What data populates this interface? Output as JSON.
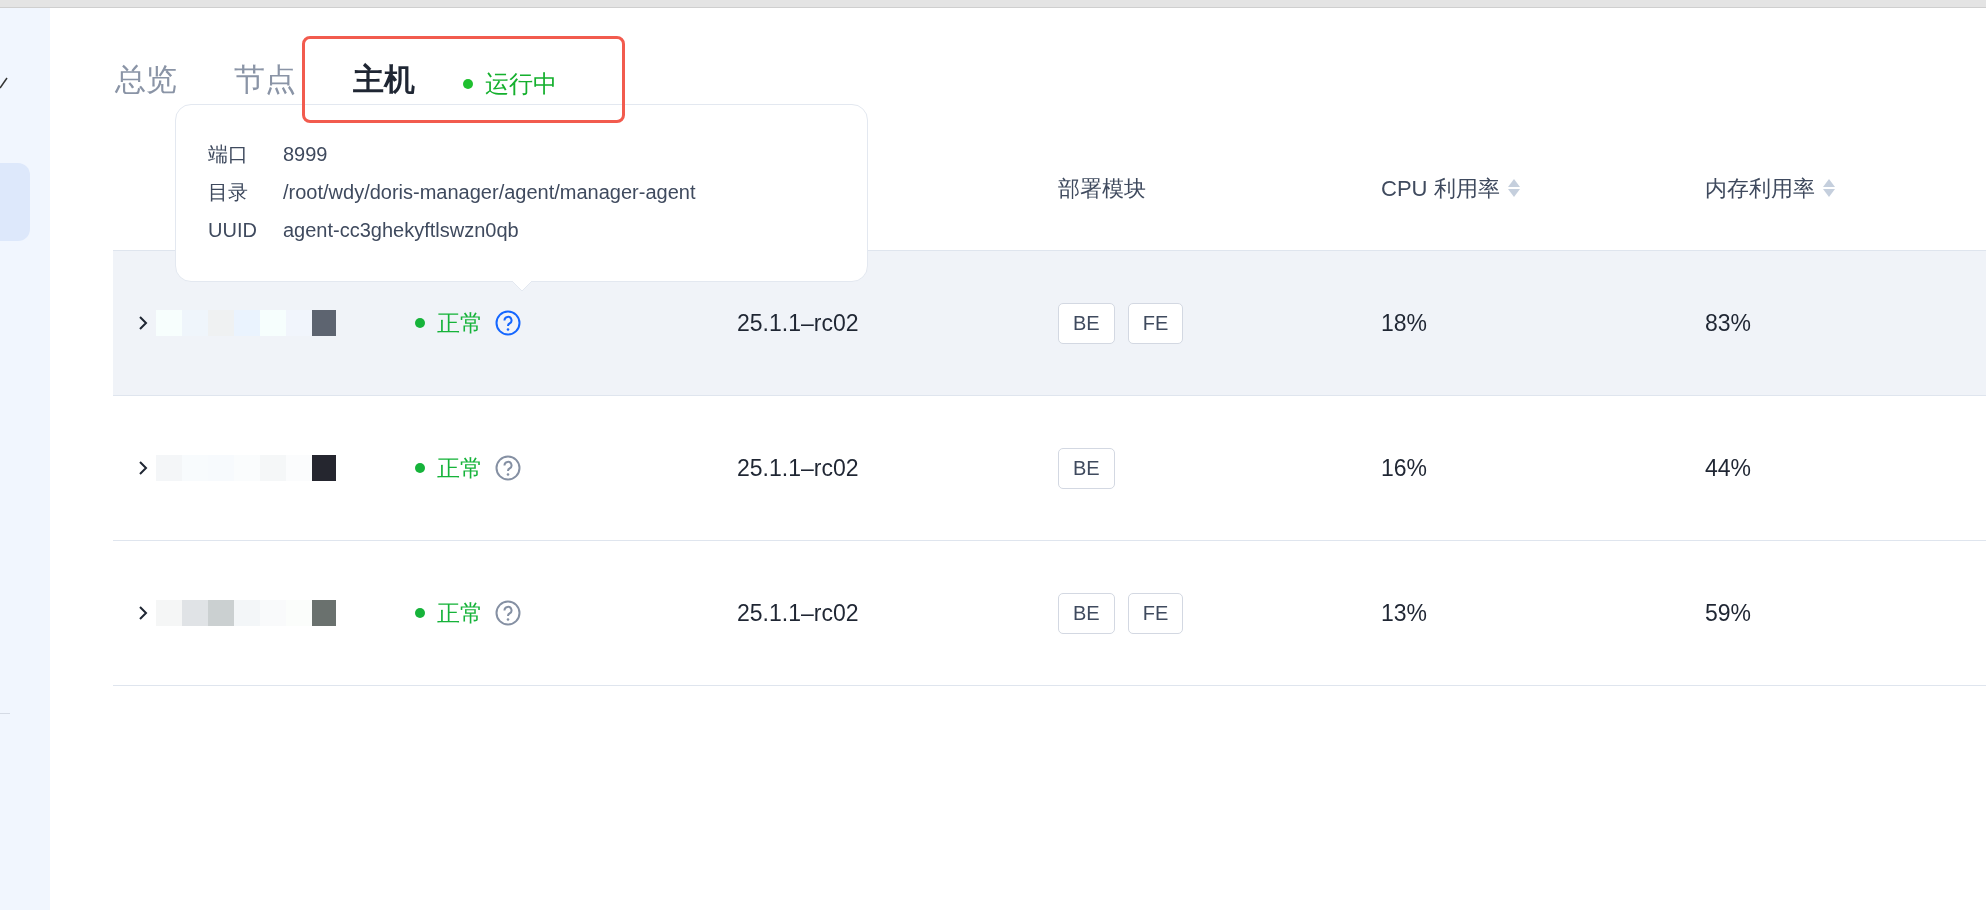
{
  "tabs": [
    {
      "label": "总览",
      "selected": false
    },
    {
      "label": "节点",
      "selected": false
    },
    {
      "label": "主机",
      "selected": true
    }
  ],
  "service_status": {
    "label": "运行中",
    "color": "#1fc02f"
  },
  "tooltip": {
    "rows": [
      {
        "label": "端口",
        "value": "8999"
      },
      {
        "label": "目录",
        "value": "/root/wdy/doris-manager/agent/manager-agent"
      },
      {
        "label": "UUID",
        "value": "agent-cc3ghekyftlswzn0qb"
      }
    ]
  },
  "table": {
    "columns": [
      {
        "label": "部署模块",
        "sortable": false
      },
      {
        "label": "CPU 利用率",
        "sortable": true
      },
      {
        "label": "内存利用率",
        "sortable": true
      }
    ],
    "rows": [
      {
        "highlighted": true,
        "status": "正常",
        "help_active": true,
        "version": "25.1.1–rc02",
        "modules": [
          "BE",
          "FE"
        ],
        "cpu": "18%",
        "memory": "83%"
      },
      {
        "highlighted": false,
        "status": "正常",
        "help_active": false,
        "version": "25.1.1–rc02",
        "modules": [
          "BE"
        ],
        "cpu": "16%",
        "memory": "44%"
      },
      {
        "highlighted": false,
        "status": "正常",
        "help_active": false,
        "version": "25.1.1–rc02",
        "modules": [
          "BE",
          "FE"
        ],
        "cpu": "13%",
        "memory": "59%"
      }
    ]
  }
}
